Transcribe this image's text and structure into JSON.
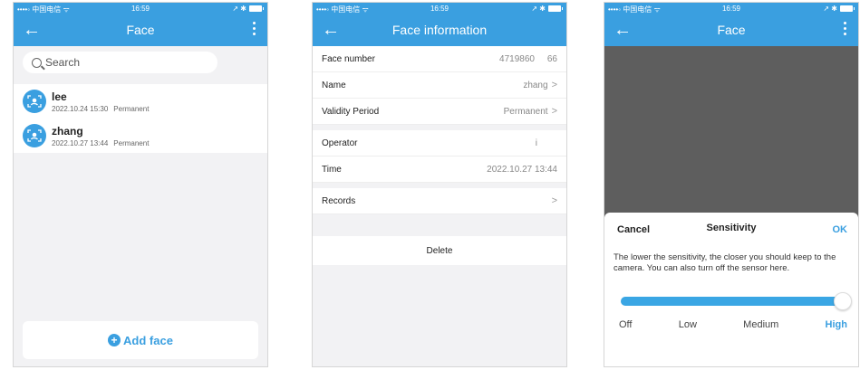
{
  "status": {
    "carrier": "••••◦ 中国电信 ᯤ",
    "time": "16:59",
    "icons": "↗ ✱"
  },
  "screen1": {
    "title": "Face",
    "search_placeholder": "Search",
    "faces": [
      {
        "name": "lee",
        "date": "2022.10.24 15:30",
        "validity": "Permanent"
      },
      {
        "name": "zhang",
        "date": "2022.10.27 13:44",
        "validity": "Permanent"
      }
    ],
    "add_face_label": "Add face"
  },
  "screen2": {
    "title": "Face information",
    "rows": {
      "face_number": {
        "label": "Face number",
        "value": "4719860     66"
      },
      "name": {
        "label": "Name",
        "value": "zhang"
      },
      "validity": {
        "label": "Validity Period",
        "value": "Permanent"
      },
      "operator": {
        "label": "Operator",
        "value": "i"
      },
      "time": {
        "label": "Time",
        "value": "2022.10.27 13:44"
      },
      "records": {
        "label": "Records"
      }
    },
    "delete_label": "Delete"
  },
  "screen3": {
    "title": "Face",
    "sheet": {
      "cancel": "Cancel",
      "title": "Sensitivity",
      "ok": "OK",
      "description": "The lower the sensitivity, the closer you should keep to the camera. You can also turn off the sensor here.",
      "level_value": 1.0,
      "levels": [
        "Off",
        "Low",
        "Medium",
        "High"
      ],
      "selected_level": "High"
    }
  },
  "icons": {
    "back": "arrow-left",
    "more": "vertical-dots",
    "search": "magnifier",
    "avatar": "face-id",
    "chevron": "chevron-right",
    "plus": "plus-circle"
  },
  "colors": {
    "accent": "#3a9fe0",
    "background": "#f2f2f4",
    "camera": "#5e5e5e"
  }
}
